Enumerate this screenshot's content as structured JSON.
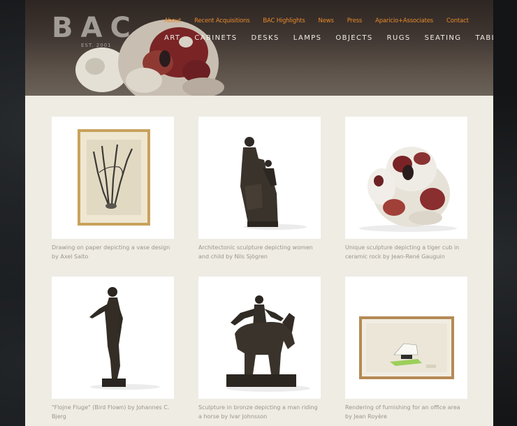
{
  "brand": {
    "logo": "BAC",
    "est": "EST. 2001"
  },
  "top_nav": [
    "About",
    "Recent Acquisitions",
    "BAC Highlights",
    "News",
    "Press",
    "Aparicio+Associates",
    "Contact"
  ],
  "category_nav": [
    "ART",
    "CABINETS",
    "DESKS",
    "LAMPS",
    "OBJECTS",
    "RUGS",
    "SEATING",
    "TABLES"
  ],
  "items": [
    {
      "icon": "framed-drawing-image",
      "caption": "Drawing on paper depicting a vase design by Axel Salto"
    },
    {
      "icon": "bronze-sculpture-image",
      "caption": "Architectonic sculpture depicting women and child by Nils Sjögren"
    },
    {
      "icon": "ceramic-tiger-image",
      "caption": "Unique sculpture depicting a tiger cub in ceramic rock by Jean-René Gauguin"
    },
    {
      "icon": "bronze-figure-image",
      "caption": "\"Flojne Fluge\" (Bird Flown) by Johannes C. Bjerg"
    },
    {
      "icon": "horse-rider-image",
      "caption": "Sculpture in bronze depicting a man riding a horse by Ivar Johnsson"
    },
    {
      "icon": "framed-rendering-image",
      "caption": "Rendering of furnishing for an office area by Jean Royère"
    }
  ]
}
